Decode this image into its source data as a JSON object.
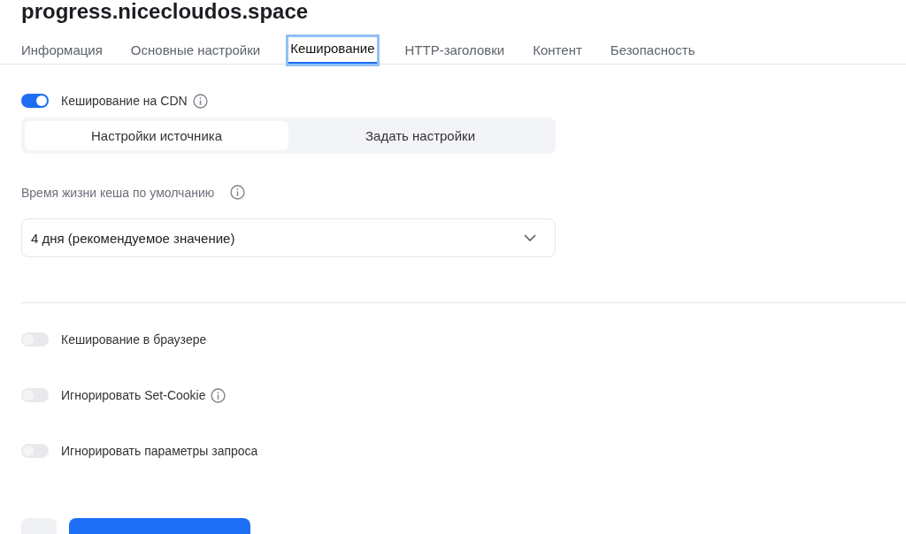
{
  "title": "progress.nicecloudos.space",
  "tabs": [
    {
      "label": "Информация",
      "selected": false
    },
    {
      "label": "Основные настройки",
      "selected": false
    },
    {
      "label": "Кеширование",
      "selected": true
    },
    {
      "label": "HTTP-заголовки",
      "selected": false
    },
    {
      "label": "Контент",
      "selected": false
    },
    {
      "label": "Безопасность",
      "selected": false
    }
  ],
  "cdn_toggle": {
    "label": "Кеширование на CDN",
    "on": true,
    "info": true
  },
  "segments": [
    {
      "label": "Настройки источника",
      "selected": true
    },
    {
      "label": "Задать настройки",
      "selected": false
    }
  ],
  "ttl": {
    "label": "Время жизни кеша по умолчанию",
    "info": true,
    "value": "4 дня (рекомендуемое значение)"
  },
  "toggles": [
    {
      "label": "Кеширование в браузере",
      "on": false,
      "info": false
    },
    {
      "label": "Игнорировать Set-Cookie",
      "on": false,
      "info": true
    },
    {
      "label": "Игнорировать параметры запроса",
      "on": false,
      "info": false
    }
  ],
  "buttons": [
    {
      "kind": "secondary"
    },
    {
      "kind": "primary"
    }
  ]
}
